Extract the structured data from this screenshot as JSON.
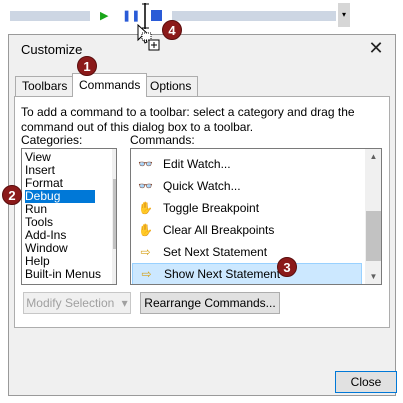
{
  "dialog": {
    "title": "Customize",
    "close_glyph": "✕",
    "tabs": [
      {
        "label": "Toolbars"
      },
      {
        "label": "Commands"
      },
      {
        "label": "Options"
      }
    ],
    "instructions": "To add a command to a toolbar: select a category and drag the command out of this dialog box to a toolbar.",
    "categories_label": "Categories:",
    "commands_label": "Commands:",
    "categories": [
      {
        "label": "View"
      },
      {
        "label": "Insert"
      },
      {
        "label": "Format"
      },
      {
        "label": "Debug"
      },
      {
        "label": "Run"
      },
      {
        "label": "Tools"
      },
      {
        "label": "Add-Ins"
      },
      {
        "label": "Window"
      },
      {
        "label": "Help"
      },
      {
        "label": "Built-in Menus"
      }
    ],
    "selected_category": "Debug",
    "commands": [
      {
        "label": "Edit Watch...",
        "icon": "edit-watch-icon",
        "glyph": "👓"
      },
      {
        "label": "Quick Watch...",
        "icon": "quick-watch-icon",
        "glyph": "👓"
      },
      {
        "label": "Toggle Breakpoint",
        "icon": "hand-icon",
        "glyph": "✋"
      },
      {
        "label": "Clear All Breakpoints",
        "icon": "clear-breakpoints-icon",
        "glyph": "✋"
      },
      {
        "label": "Set Next Statement",
        "icon": "arrow-right-icon",
        "glyph": "⇨"
      },
      {
        "label": "Show Next Statement",
        "icon": "show-next-icon",
        "glyph": "⇨"
      }
    ],
    "selected_command": "Show Next Statement",
    "buttons": {
      "modify_selection": "Modify Selection",
      "modify_arrow": "▾",
      "rearrange": "Rearrange Commands...",
      "close": "Close"
    }
  },
  "markers": [
    "1",
    "2",
    "3",
    "4"
  ],
  "colors": {
    "selection_blue": "#0078d7",
    "hover_blue": "#cce8ff",
    "marker_red": "#8b1a1a"
  }
}
